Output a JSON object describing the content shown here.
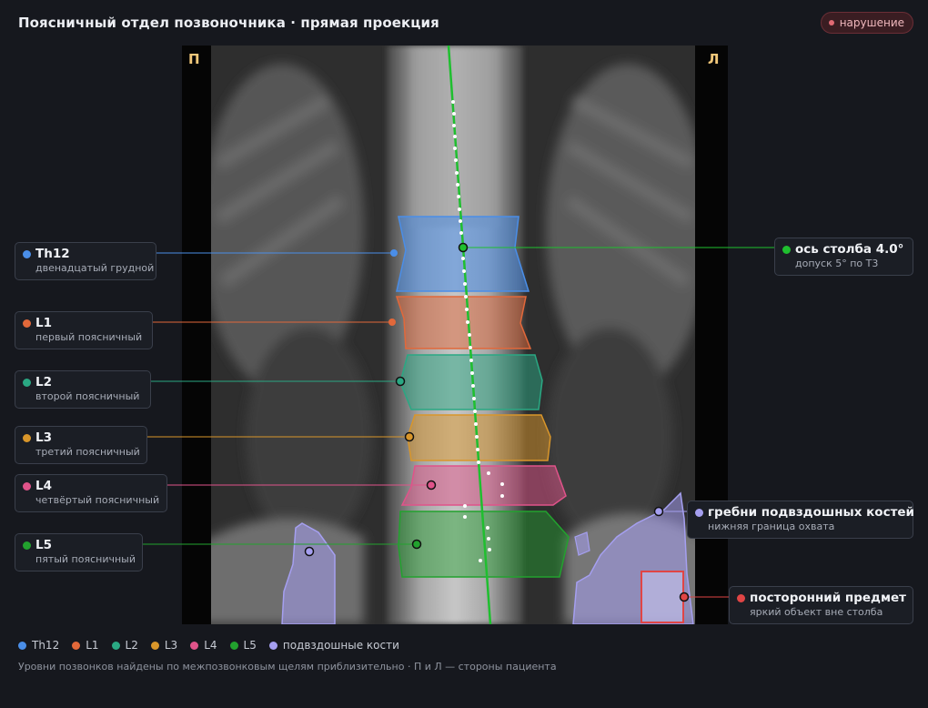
{
  "header": {
    "title": "Поясничный отдел позвоночника · прямая проекция",
    "badge": "нарушение"
  },
  "image": {
    "side_right": "П",
    "side_left": "Л"
  },
  "labels": {
    "th12": {
      "title": "Th12",
      "subtitle": "двенадцатый грудной",
      "color": "#4a8ee8"
    },
    "l1": {
      "title": "L1",
      "subtitle": "первый поясничный",
      "color": "#e2683a"
    },
    "l2": {
      "title": "L2",
      "subtitle": "второй поясничный",
      "color": "#2aa883"
    },
    "l3": {
      "title": "L3",
      "subtitle": "третий поясничный",
      "color": "#d9962a"
    },
    "l4": {
      "title": "L4",
      "subtitle": "четвёртый поясничный",
      "color": "#e0538a"
    },
    "l5": {
      "title": "L5",
      "subtitle": "пятый поясничный",
      "color": "#22a22e"
    },
    "axis": {
      "title": "ось столба 4.0°",
      "subtitle": "допуск 5° по Т3",
      "color": "#1fbf2f"
    },
    "iliac": {
      "title": "гребни подвздошных костей",
      "subtitle": "нижняя граница охвата",
      "color": "#a59ff0"
    },
    "foreign": {
      "title": "посторонний предмет",
      "subtitle": "яркий объект вне столба",
      "color": "#e04545"
    }
  },
  "legend": [
    {
      "label": "Th12",
      "color": "#4a8ee8"
    },
    {
      "label": "L1",
      "color": "#e2683a"
    },
    {
      "label": "L2",
      "color": "#2aa883"
    },
    {
      "label": "L3",
      "color": "#d9962a"
    },
    {
      "label": "L4",
      "color": "#e0538a"
    },
    {
      "label": "L5",
      "color": "#22a22e"
    },
    {
      "label": "подвздошные кости",
      "color": "#a59ff0"
    }
  ],
  "footnote": "Уровни позвонков найдены по межпозвонковым щелям приблизительно · П и Л — стороны пациента"
}
